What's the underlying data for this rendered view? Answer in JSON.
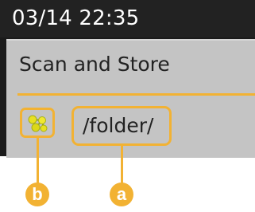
{
  "status_bar": {
    "clock": "03/14 22:35"
  },
  "panel": {
    "title": "Scan and Store",
    "destination_path": "/folder/",
    "storage_icon": "network-share-icon"
  },
  "callouts": {
    "a": "a",
    "b": "b"
  },
  "colors": {
    "accent": "#f2b233",
    "screen_background": "#1b1b1b",
    "panel_background": "#c4c4c4"
  }
}
